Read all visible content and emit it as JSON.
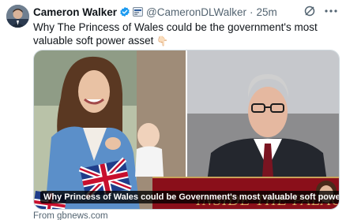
{
  "tweet": {
    "author_name": "Cameron Walker",
    "author_handle": "@CameronDLWalker",
    "separator": "·",
    "timestamp": "25m",
    "text": "Why The Princess of Wales could be the government's most valuable soft power asset",
    "emoji": "👇🏻"
  },
  "card": {
    "caption": "Why Princess of Wales could be Government's most valuable soft power asset",
    "overlay_text": "INSIDE THE PALACE"
  },
  "link_source": "From gbnews.com",
  "colors": {
    "verified": "#1d9bf0",
    "text": "#0f1419",
    "secondary": "#536471",
    "banner_red": "#8a0f1a"
  }
}
